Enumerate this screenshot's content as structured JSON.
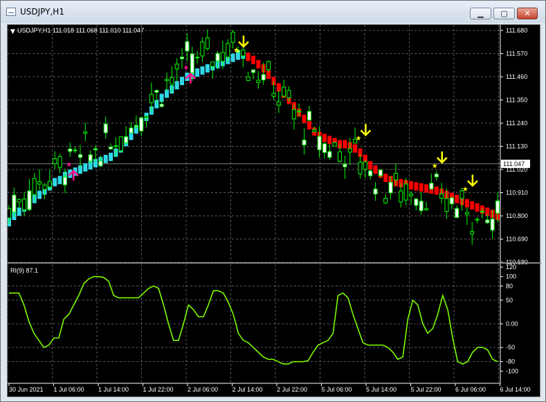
{
  "window": {
    "title": "USDJPY,H1",
    "minimize_icon": "minimize-icon",
    "maximize_icon": "maximize-icon",
    "close_icon": "close-icon"
  },
  "colors": {
    "background": "#000000",
    "grid": "#5b5b5b",
    "axis_text": "#ffffff",
    "bull_candle": "#00ff00",
    "bear_candle": "#00ff00",
    "bull_body": "#ffffff",
    "ma_up": "#30d8e8",
    "ma_down": "#ff0000",
    "buy_arrow": "#ff1493",
    "sell_arrow": "#ffff00",
    "rsi_line": "#7cfc00",
    "hline": "#808080"
  },
  "main_panel": {
    "info": "USDJPY,H1  111.018 111.068 111.010 111.047",
    "price_ticks": [
      "111.680",
      "111.570",
      "111.460",
      "111.350",
      "111.240",
      "111.130",
      "111.020",
      "110.910",
      "110.800",
      "110.690",
      "110.580"
    ],
    "current_price": "111.047"
  },
  "rsi_panel": {
    "label": "RI(9) 87.1",
    "ticks": [
      "120",
      "100",
      "80",
      "50",
      "0.00",
      "-50",
      "-80",
      "-100"
    ]
  },
  "time_labels": [
    "30 Jun 2021",
    "1 Jul 06:00",
    "1 Jul 14:00",
    "1 Jul 22:00",
    "2 Jul 06:00",
    "2 Jul 14:00",
    "2 Jul 22:00",
    "5 Jul 06:00",
    "5 Jul 14:00",
    "5 Jul 22:00",
    "6 Jul 06:00",
    "6 Jul 14:00"
  ],
  "chart_data": {
    "type": "candlestick",
    "symbol": "USDJPY",
    "timeframe": "H1",
    "ohlc_current": {
      "open": 111.018,
      "high": 111.068,
      "low": 111.01,
      "close": 111.047
    },
    "ylim": [
      110.58,
      111.68
    ],
    "ma_line": [
      110.77,
      110.8,
      110.82,
      110.84,
      110.86,
      110.88,
      110.9,
      110.92,
      110.94,
      110.96,
      110.97,
      110.99,
      111.0,
      111.01,
      111.02,
      111.03,
      111.04,
      111.05,
      111.06,
      111.07,
      111.08,
      111.1,
      111.12,
      111.15,
      111.18,
      111.21,
      111.24,
      111.27,
      111.3,
      111.33,
      111.36,
      111.38,
      111.4,
      111.42,
      111.44,
      111.46,
      111.47,
      111.48,
      111.49,
      111.5,
      111.51,
      111.52,
      111.53,
      111.54,
      111.55,
      111.56,
      111.565,
      111.555,
      111.54,
      111.52,
      111.5,
      111.47,
      111.44,
      111.41,
      111.38,
      111.35,
      111.32,
      111.29,
      111.26,
      111.23,
      111.2,
      111.18,
      111.17,
      111.16,
      111.15,
      111.14,
      111.14,
      111.13,
      111.12,
      111.1,
      111.07,
      111.04,
      111.02,
      111.0,
      110.98,
      110.97,
      110.96,
      110.955,
      110.95,
      110.945,
      110.94,
      110.935,
      110.93,
      110.925,
      110.92,
      110.91,
      110.9,
      110.89,
      110.88,
      110.87,
      110.86,
      110.85,
      110.84,
      110.83,
      110.82,
      110.81,
      110.8
    ],
    "ma_turn_index": 47,
    "buy_signals": [
      {
        "index": 12,
        "price": 111.04
      },
      {
        "index": 35,
        "price": 111.5
      }
    ],
    "sell_signals": [
      {
        "index": 45,
        "price": 111.61
      },
      {
        "index": 69,
        "price": 111.19
      },
      {
        "index": 84,
        "price": 111.06
      },
      {
        "index": 90,
        "price": 110.95
      }
    ],
    "rsi_title": "RI(9)",
    "rsi_value": 87.1,
    "rsi_ylim": [
      -120,
      120
    ],
    "rsi_levels": [
      -100,
      -80,
      -50,
      0,
      50,
      80,
      100,
      120
    ],
    "rsi": [
      65,
      65,
      65,
      40,
      5,
      -20,
      -35,
      -50,
      -45,
      -30,
      -30,
      10,
      20,
      40,
      60,
      85,
      95,
      100,
      100,
      98,
      90,
      60,
      55,
      55,
      55,
      55,
      55,
      65,
      75,
      80,
      75,
      40,
      0,
      -35,
      -35,
      0,
      40,
      30,
      15,
      15,
      40,
      70,
      70,
      65,
      45,
      20,
      -20,
      -35,
      -40,
      -50,
      -60,
      -70,
      -75,
      -75,
      -80,
      -85,
      -85,
      -80,
      -80,
      -80,
      -78,
      -60,
      -45,
      -40,
      -35,
      -20,
      60,
      65,
      55,
      20,
      -10,
      -40,
      -45,
      -45,
      -45,
      -45,
      -50,
      -60,
      -75,
      -70,
      10,
      50,
      40,
      0,
      -20,
      -10,
      20,
      60,
      30,
      -30,
      -80,
      -85,
      -80,
      -60,
      -50,
      -50,
      -55,
      -75,
      -80
    ]
  }
}
